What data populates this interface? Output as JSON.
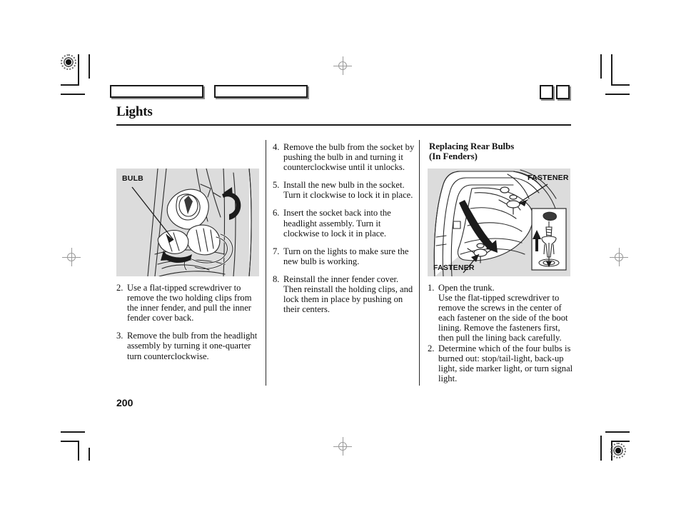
{
  "document": {
    "section_title": "Lights",
    "page_number": "200"
  },
  "columns": {
    "left": {
      "figure": {
        "label": "BULB"
      },
      "steps": [
        {
          "number": "2.",
          "text": "Use a flat-tipped screwdriver to remove the two holding clips from the inner fender, and pull the inner fender cover back."
        },
        {
          "number": "3.",
          "text": "Remove the bulb from the headlight assembly by turning it one-quarter turn counterclockwise."
        }
      ]
    },
    "middle": {
      "steps": [
        {
          "number": "4.",
          "text": "Remove the bulb from the socket by pushing the bulb in and turning it counterclockwise until it unlocks."
        },
        {
          "number": "5.",
          "text": "Install the new bulb in the socket. Turn it clockwise to lock it in place."
        },
        {
          "number": "6.",
          "text": "Insert the socket back into the headlight assembly. Turn it clockwise to lock it in place."
        },
        {
          "number": "7.",
          "text": "Turn on the lights to make sure the new bulb is working."
        },
        {
          "number": "8.",
          "text": "Reinstall the inner fender cover. Then reinstall the holding clips, and lock them in place by pushing on their centers."
        }
      ]
    },
    "right": {
      "heading_line1": "Replacing Rear Bulbs",
      "heading_line2": "(In Fenders)",
      "figure": {
        "label_top": "FASTENER",
        "label_bottom": "FASTENER"
      },
      "steps": [
        {
          "number": "1.",
          "text": "Open the trunk.",
          "continuation": "Use the flat-tipped screwdriver to remove the screws in the center of each fastener on the side of the boot lining. Remove the fasteners first, then pull the lining back carefully."
        },
        {
          "number": "2.",
          "text": "Determine which of the four bulbs is burned out: stop/tail-light, back-up light, side marker light, or turn signal light."
        }
      ]
    }
  },
  "colors": {
    "figure_background": "#dcdcdc",
    "ink": "#111111",
    "rule": "#1a1a1a"
  }
}
